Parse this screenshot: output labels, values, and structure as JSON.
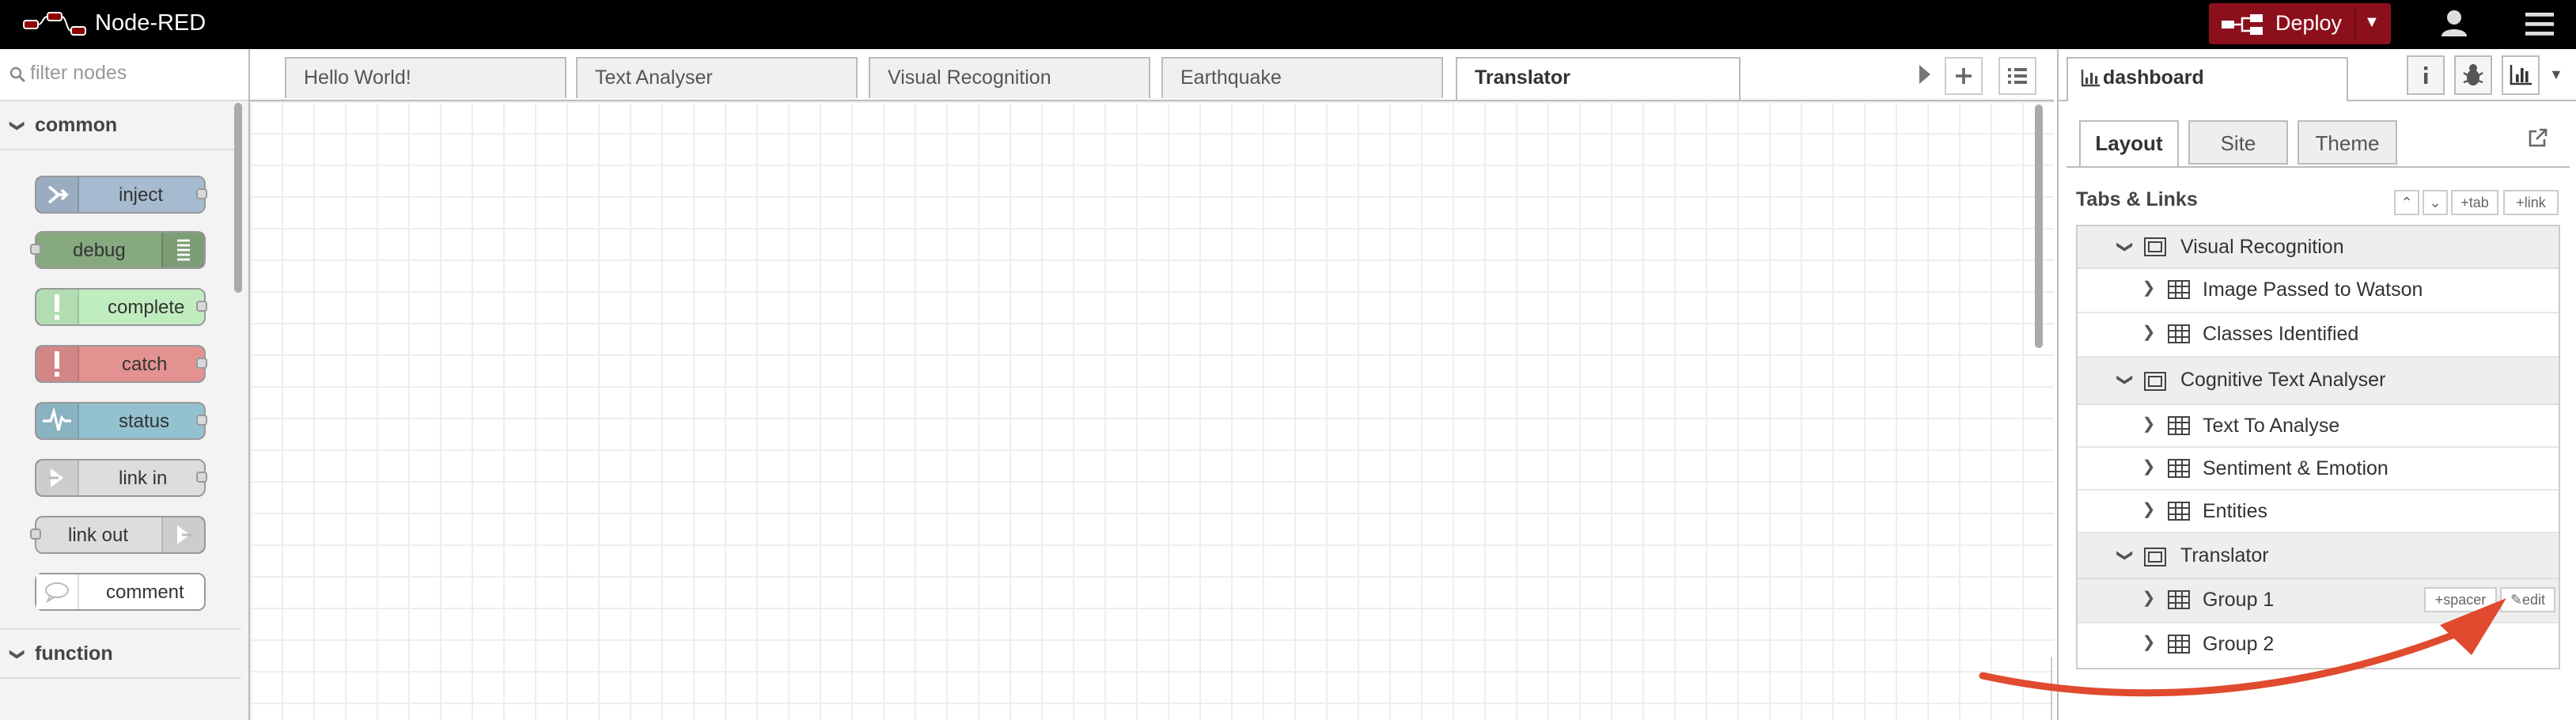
{
  "header": {
    "title": "Node-RED",
    "deploy_label": "Deploy"
  },
  "palette": {
    "search_placeholder": "filter nodes",
    "categories": [
      {
        "label": "common",
        "nodes": [
          {
            "label": "inject",
            "color": "#a6bbcf"
          },
          {
            "label": "debug",
            "color": "#87a980"
          },
          {
            "label": "complete",
            "color": "#c0edc0"
          },
          {
            "label": "catch",
            "color": "#e49191"
          },
          {
            "label": "status",
            "color": "#94c1d0"
          },
          {
            "label": "link in",
            "color": "#dddddd"
          },
          {
            "label": "link out",
            "color": "#dddddd"
          },
          {
            "label": "comment",
            "color": "#ffffff"
          }
        ]
      },
      {
        "label": "function"
      }
    ]
  },
  "workspace": {
    "tabs": [
      "Hello World!",
      "Text Analyser",
      "Visual Recognition",
      "Earthquake",
      "Translator"
    ],
    "active_tab": "Translator"
  },
  "sidebar": {
    "active_tab": "dashboard",
    "subtabs": [
      "Layout",
      "Site",
      "Theme"
    ],
    "section_title": "Tabs & Links",
    "section_buttons": {
      "tab": "tab",
      "link": "link"
    },
    "tree": [
      {
        "label": "Visual Recognition",
        "groups": [
          "Image Passed to Watson",
          "Classes Identified"
        ]
      },
      {
        "label": "Cognitive Text Analyser",
        "groups": [
          "Text To Analyse",
          "Sentiment & Emotion",
          "Entities"
        ]
      },
      {
        "label": "Translator",
        "groups": [
          "Group 1",
          "Group 2"
        ]
      }
    ],
    "row_buttons": {
      "spacer": "spacer",
      "edit": "edit"
    }
  },
  "colors": {
    "deploy": "#8c101c",
    "annotation_arrow": "#e04a2f",
    "header": "#000000"
  }
}
